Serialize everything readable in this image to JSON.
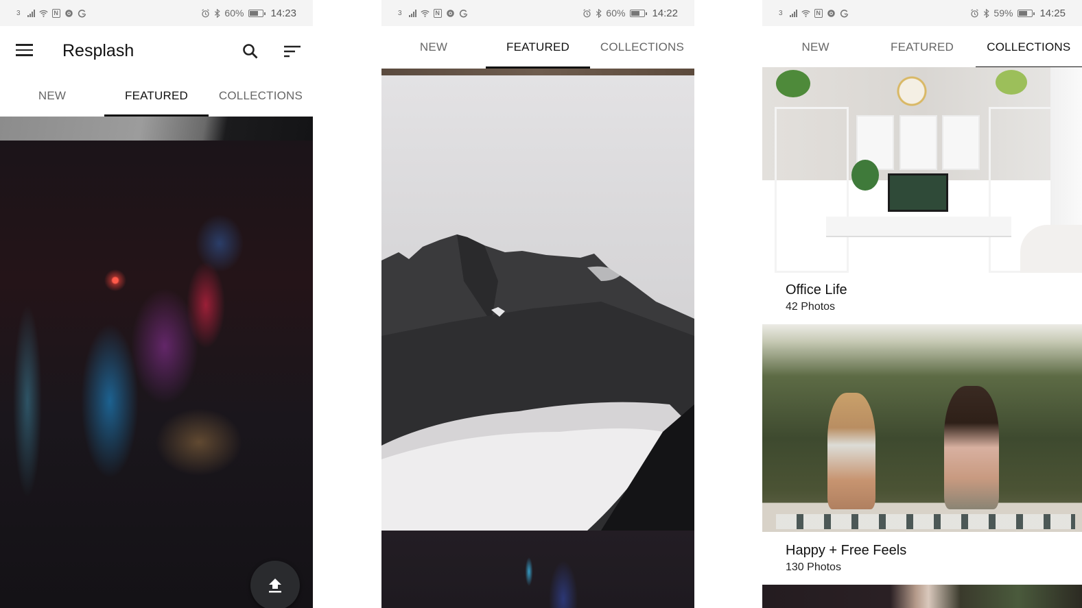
{
  "screens": [
    {
      "status": {
        "carrier": "3",
        "battery": "60%",
        "battery_level": 0.6,
        "time": "14:23"
      },
      "appbar": {
        "title": "Resplash"
      },
      "tabs": [
        {
          "label": "NEW",
          "active": false
        },
        {
          "label": "FEATURED",
          "active": true
        },
        {
          "label": "COLLECTIONS",
          "active": false
        }
      ],
      "feed": [
        {
          "description": "Foggy mountain (partially visible)"
        },
        {
          "description": "Neon-lit city alley at night with AMBER sign"
        }
      ],
      "fab": {
        "icon": "upload-icon"
      }
    },
    {
      "status": {
        "carrier": "3",
        "battery": "60%",
        "battery_level": 0.6,
        "time": "14:22"
      },
      "tabs": [
        {
          "label": "NEW",
          "active": false
        },
        {
          "label": "FEATURED",
          "active": true
        },
        {
          "label": "COLLECTIONS",
          "active": false
        }
      ],
      "feed": [
        {
          "description": "Brown texture (partially visible)"
        },
        {
          "description": "Dark mountain ridge in fog"
        },
        {
          "description": "Neon city at night (partially visible)"
        }
      ]
    },
    {
      "status": {
        "carrier": "3",
        "battery": "59%",
        "battery_level": 0.59,
        "time": "14:25"
      },
      "tabs": [
        {
          "label": "NEW",
          "active": false
        },
        {
          "label": "FEATURED",
          "active": false
        },
        {
          "label": "COLLECTIONS",
          "active": true
        }
      ],
      "collections": [
        {
          "title": "Office Life",
          "count": "42 Photos",
          "description": "White desk workspace with shelves and plants"
        },
        {
          "title": "Happy + Free Feels",
          "count": "130 Photos",
          "description": "Two women laughing on a blanket in tall grass"
        }
      ]
    }
  ],
  "colors": {
    "status_bg": "#f4f4f4",
    "tab_active": "#111111",
    "tab_inactive": "#666666",
    "fab_bg": "#2a2b2e"
  }
}
